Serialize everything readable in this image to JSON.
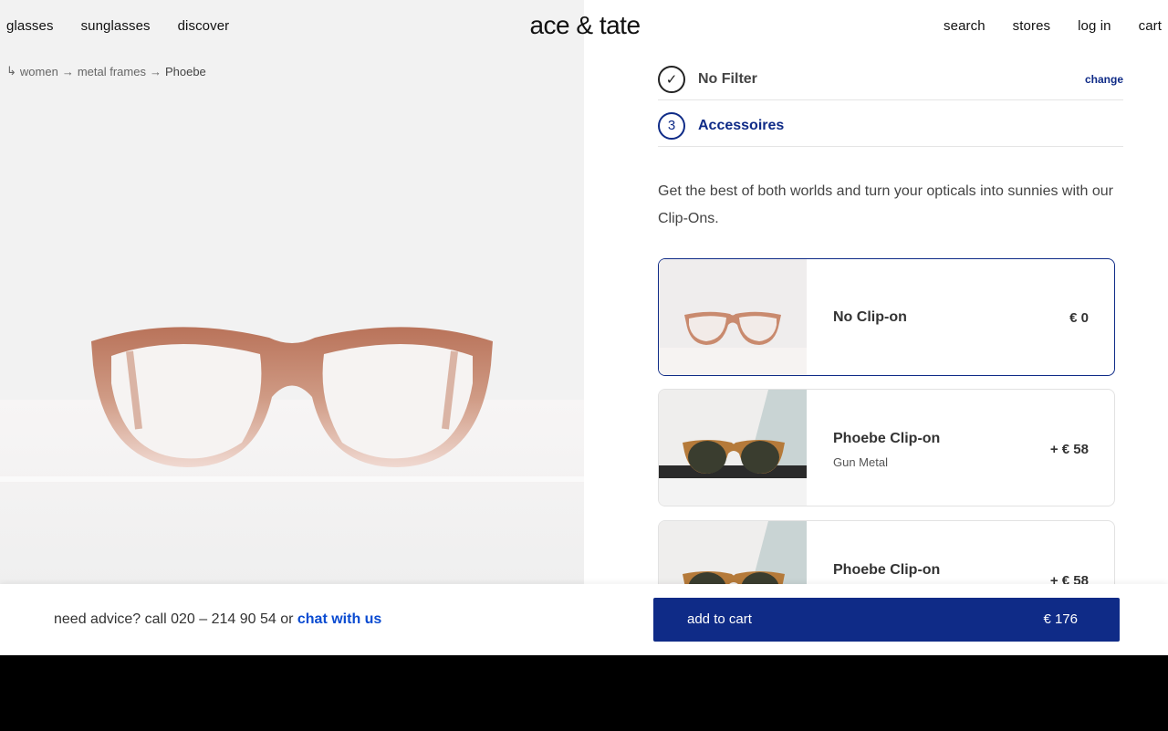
{
  "header": {
    "nav_left": [
      "glasses",
      "sunglasses",
      "discover"
    ],
    "logo": "ace & tate",
    "nav_right": [
      "search",
      "stores",
      "log in",
      "cart"
    ]
  },
  "breadcrumb": {
    "arrow_start": "↳",
    "items": [
      "women",
      "metal frames"
    ],
    "separator": "→",
    "current": "Phoebe"
  },
  "steps": [
    {
      "marker": "✓",
      "title": "No Filter",
      "action": "change",
      "state": "done"
    },
    {
      "marker": "3",
      "title": "Accessoires",
      "state": "active"
    }
  ],
  "description": "Get the best of both worlds and turn your opticals into sunnies with our Clip-Ons.",
  "options": [
    {
      "name": "No Clip-on",
      "variant": "",
      "price": "€ 0",
      "selected": true
    },
    {
      "name": "Phoebe Clip-on",
      "variant": "Gun Metal",
      "price": "+ € 58",
      "selected": false
    },
    {
      "name": "Phoebe Clip-on",
      "variant": "",
      "price": "+ € 58",
      "selected": false
    }
  ],
  "bottom": {
    "advice_text": "need advice? call 020 – 214 90 54 or ",
    "chat_link": "chat with us",
    "cart_label": "add to cart",
    "cart_total": "€ 176"
  },
  "colors": {
    "brand_blue": "#0f2b87",
    "link_blue": "#0a4bd1",
    "frame_tortoise": "#c98a6e"
  }
}
